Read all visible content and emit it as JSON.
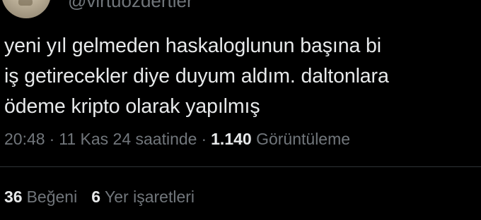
{
  "author": {
    "handle": "@virtuozdertler"
  },
  "tweet": {
    "text": "yeni yıl gelmeden haskaloglunun başına bi\niş getirecekler diye duyum aldım. daltonlara\nödeme kripto olarak yapılmış"
  },
  "meta": {
    "time": "20:48",
    "separator": "·",
    "date": "11 Kas 24 saatinde",
    "views_count": "1.140",
    "views_label": "Görüntüleme"
  },
  "stats": {
    "likes_count": "36",
    "likes_label": "Beğeni",
    "bookmarks_count": "6",
    "bookmarks_label": "Yer işaretleri"
  },
  "colors": {
    "background": "#000000",
    "text_primary": "#e7e9ea",
    "text_secondary": "#71767b",
    "divider": "#2f3336"
  }
}
